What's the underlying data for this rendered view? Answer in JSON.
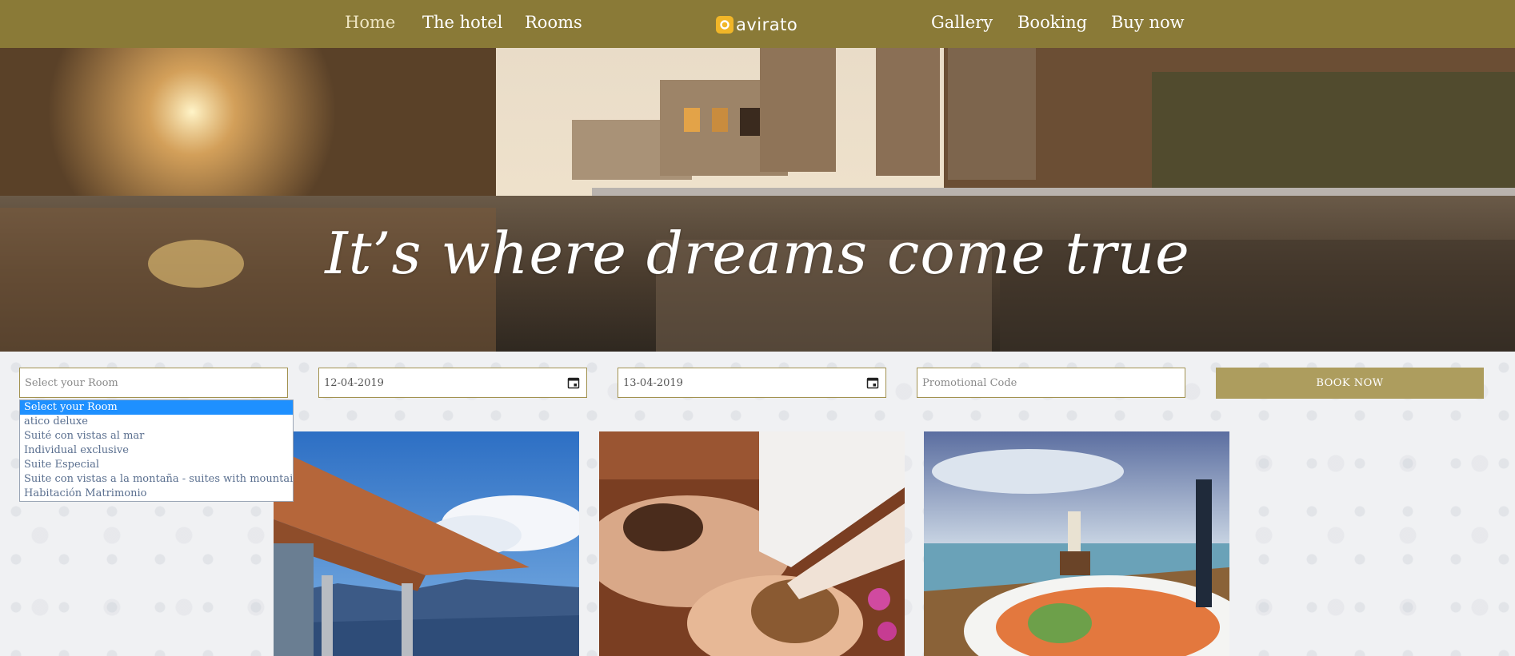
{
  "nav": {
    "left_items": [
      "Home",
      "The hotel",
      "Rooms"
    ],
    "right_items": [
      "Gallery",
      "Booking",
      "Buy now"
    ],
    "active": "Home",
    "logo_text": "avirato",
    "logo_icon": "avirato-logo-icon",
    "background_color": "#8a7a37"
  },
  "hero": {
    "title": "It’s where dreams come true",
    "image": "temple-reflection-pool-sunset"
  },
  "booking": {
    "room_select": {
      "placeholder": "Select your Room",
      "options": [
        "Select your Room",
        "atico deluxe",
        "Suité con vistas al mar",
        "Individual exclusive",
        "Suite Especial",
        "Suite con vistas a la montaña - suites with mountain view",
        "Habitación Matrimonio"
      ],
      "selected_index": 0
    },
    "checkin": "12-04-2019",
    "checkout": "13-04-2019",
    "promo_placeholder": "Promotional Code",
    "book_button": "BOOK NOW",
    "accent_color": "#ad9d5e"
  },
  "cards": [
    {
      "image": "tiled-roof-mountain-view"
    },
    {
      "image": "spa-massage"
    },
    {
      "image": "seafood-plate-seaside"
    }
  ]
}
